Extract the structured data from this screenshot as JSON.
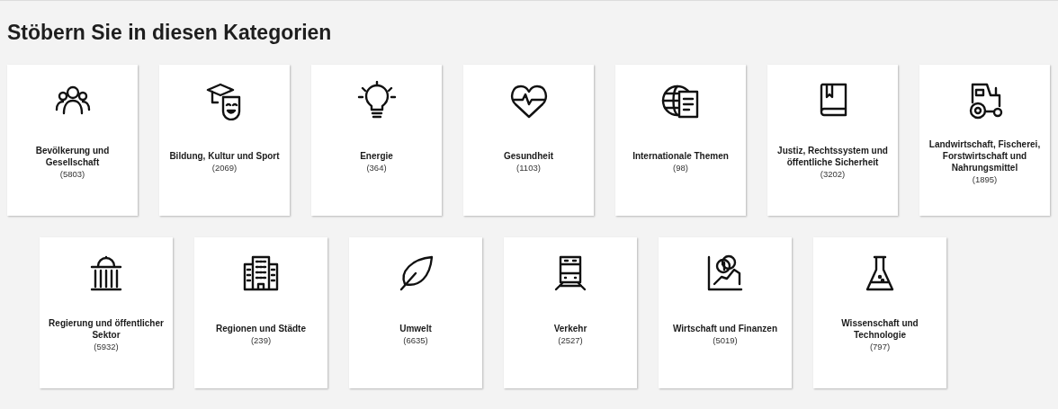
{
  "title": "Stöbern Sie in diesen Kategorien",
  "rows": [
    {
      "categories": [
        {
          "label": "Bevölkerung und Gesellschaft",
          "count": "(5803)"
        },
        {
          "label": "Bildung, Kultur und Sport",
          "count": "(2069)"
        },
        {
          "label": "Energie",
          "count": "(364)"
        },
        {
          "label": "Gesundheit",
          "count": "(1103)"
        },
        {
          "label": "Internationale Themen",
          "count": "(98)"
        },
        {
          "label": "Justiz, Rechtssystem und öffentliche Sicherheit",
          "count": "(3202)"
        },
        {
          "label": "Landwirtschaft, Fischerei, Forstwirtschaft und Nahrungsmittel",
          "count": "(1895)"
        }
      ]
    },
    {
      "categories": [
        {
          "label": "Regierung und öffentlicher Sektor",
          "count": "(5932)"
        },
        {
          "label": "Regionen und Städte",
          "count": "(239)"
        },
        {
          "label": "Umwelt",
          "count": "(6635)"
        },
        {
          "label": "Verkehr",
          "count": "(2527)"
        },
        {
          "label": "Wirtschaft und Finanzen",
          "count": "(5019)"
        },
        {
          "label": "Wissenschaft und Technologie",
          "count": "(797)"
        }
      ]
    }
  ]
}
